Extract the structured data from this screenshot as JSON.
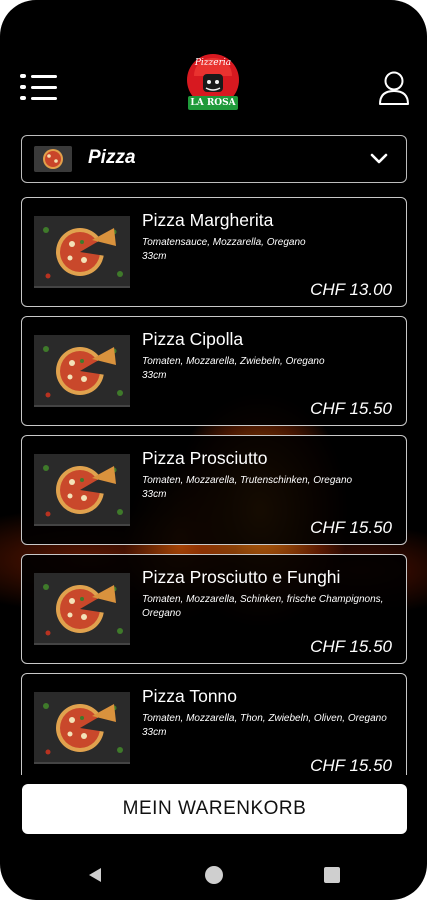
{
  "header": {
    "logo_text_top": "Pizzeria",
    "logo_text_bottom": "LA ROSA",
    "menu_icon": "menu-list-icon",
    "user_icon": "user-icon"
  },
  "category": {
    "selected": "Pizza",
    "icon": "chevron-down-icon"
  },
  "products": [
    {
      "name": "Pizza Margherita",
      "description": "Tomatensauce, Mozzarella, Oregano",
      "size": "33cm",
      "price": "CHF 13.00"
    },
    {
      "name": "Pizza Cipolla",
      "description": "Tomaten, Mozzarella, Zwiebeln, Oregano",
      "size": "33cm",
      "price": "CHF 15.50"
    },
    {
      "name": "Pizza Prosciutto",
      "description": "Tomaten, Mozzarella, Trutenschinken, Oregano",
      "size": "33cm",
      "price": "CHF 15.50"
    },
    {
      "name": "Pizza Prosciutto e Funghi",
      "description": "Tomaten, Mozzarella, Schinken, frische Champignons, Oregano",
      "size": "",
      "price": "CHF 15.50"
    },
    {
      "name": "Pizza Tonno",
      "description": "Tomaten, Mozzarella, Thon, Zwiebeln, Oliven, Oregano",
      "size": "33cm",
      "price": "CHF 15.50"
    }
  ],
  "cart_button": "MEIN WARENKORB",
  "colors": {
    "background": "#000000",
    "card_border": "#c8c8c8",
    "logo_red": "#d71920",
    "logo_green": "#1f9a3a",
    "button_bg": "#ffffff"
  },
  "navbar": {
    "back_icon": "back-triangle-icon",
    "home_icon": "home-circle-icon",
    "recent_icon": "recent-square-icon"
  }
}
